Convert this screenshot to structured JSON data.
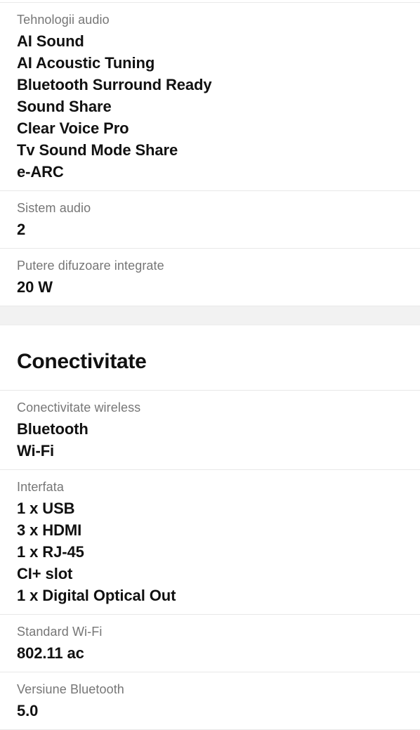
{
  "document": {
    "type": "product-specification-sheet",
    "language": "ro"
  },
  "sections": [
    {
      "id": "audio",
      "heading": null,
      "rows": [
        {
          "label": "Tehnologii audio",
          "values": [
            "AI Sound",
            "AI Acoustic Tuning",
            "Bluetooth Surround Ready",
            "Sound Share",
            "Clear Voice Pro",
            "Tv Sound Mode Share",
            "e-ARC"
          ]
        },
        {
          "label": "Sistem audio",
          "values": [
            "2"
          ]
        },
        {
          "label": "Putere difuzoare integrate",
          "values": [
            "20 W"
          ]
        }
      ]
    },
    {
      "id": "conectivitate",
      "heading": "Conectivitate",
      "rows": [
        {
          "label": "Conectivitate wireless",
          "values": [
            "Bluetooth",
            "Wi-Fi"
          ]
        },
        {
          "label": "Interfata",
          "values": [
            "1 x USB",
            "3 x HDMI",
            "1 x RJ-45",
            "CI+ slot",
            "1 x Digital Optical Out"
          ]
        },
        {
          "label": "Standard Wi-Fi",
          "values": [
            "802.11 ac"
          ]
        },
        {
          "label": "Versiune Bluetooth",
          "values": [
            "5.0"
          ]
        }
      ]
    }
  ],
  "colors": {
    "label_text": "#767676",
    "value_text": "#111111",
    "divider": "#e8e8e8",
    "section_gap_background": "#f2f2f2",
    "page_background": "#ffffff"
  }
}
